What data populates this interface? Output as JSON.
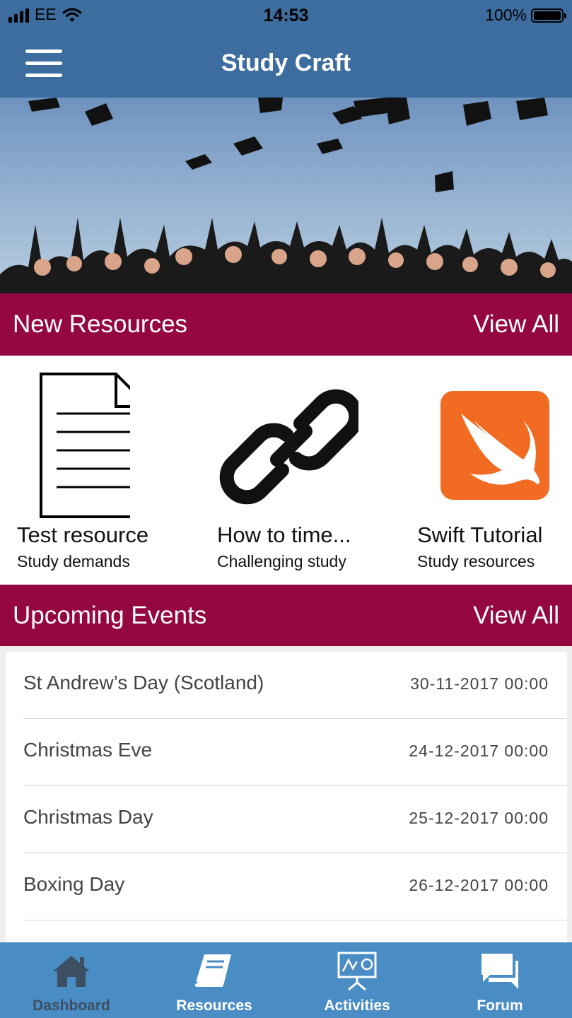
{
  "status_bar": {
    "carrier": "EE",
    "time": "14:53",
    "battery": "100%"
  },
  "nav": {
    "title": "Study Craft",
    "menu_icon": "hamburger-icon"
  },
  "new_resources": {
    "title": "New Resources",
    "view_all": "View All",
    "items": [
      {
        "title": "Test resource",
        "subtitle": "Study demands",
        "icon": "document-icon"
      },
      {
        "title": "How to time...",
        "subtitle": "Challenging study",
        "icon": "link-icon"
      },
      {
        "title": "Swift Tutorial",
        "subtitle": "Study resources",
        "icon": "swift-icon"
      }
    ]
  },
  "upcoming_events": {
    "title": "Upcoming Events",
    "view_all": "View All",
    "items": [
      {
        "name": "St Andrew’s Day (Scotland)",
        "date": "30-11-2017 00:00"
      },
      {
        "name": "Christmas Eve",
        "date": "24-12-2017 00:00"
      },
      {
        "name": "Christmas Day",
        "date": "25-12-2017 00:00"
      },
      {
        "name": "Boxing Day",
        "date": "26-12-2017 00:00"
      }
    ]
  },
  "tabs": [
    {
      "label": "Dashboard",
      "icon": "home-icon",
      "active": true
    },
    {
      "label": "Resources",
      "icon": "book-icon",
      "active": false
    },
    {
      "label": "Activities",
      "icon": "presentation-icon",
      "active": false
    },
    {
      "label": "Forum",
      "icon": "chat-icon",
      "active": false
    }
  ],
  "colors": {
    "nav": "#3c6d9e",
    "section_header": "#950741",
    "tabbar": "#4a8cc4",
    "swift": "#f05a23"
  }
}
